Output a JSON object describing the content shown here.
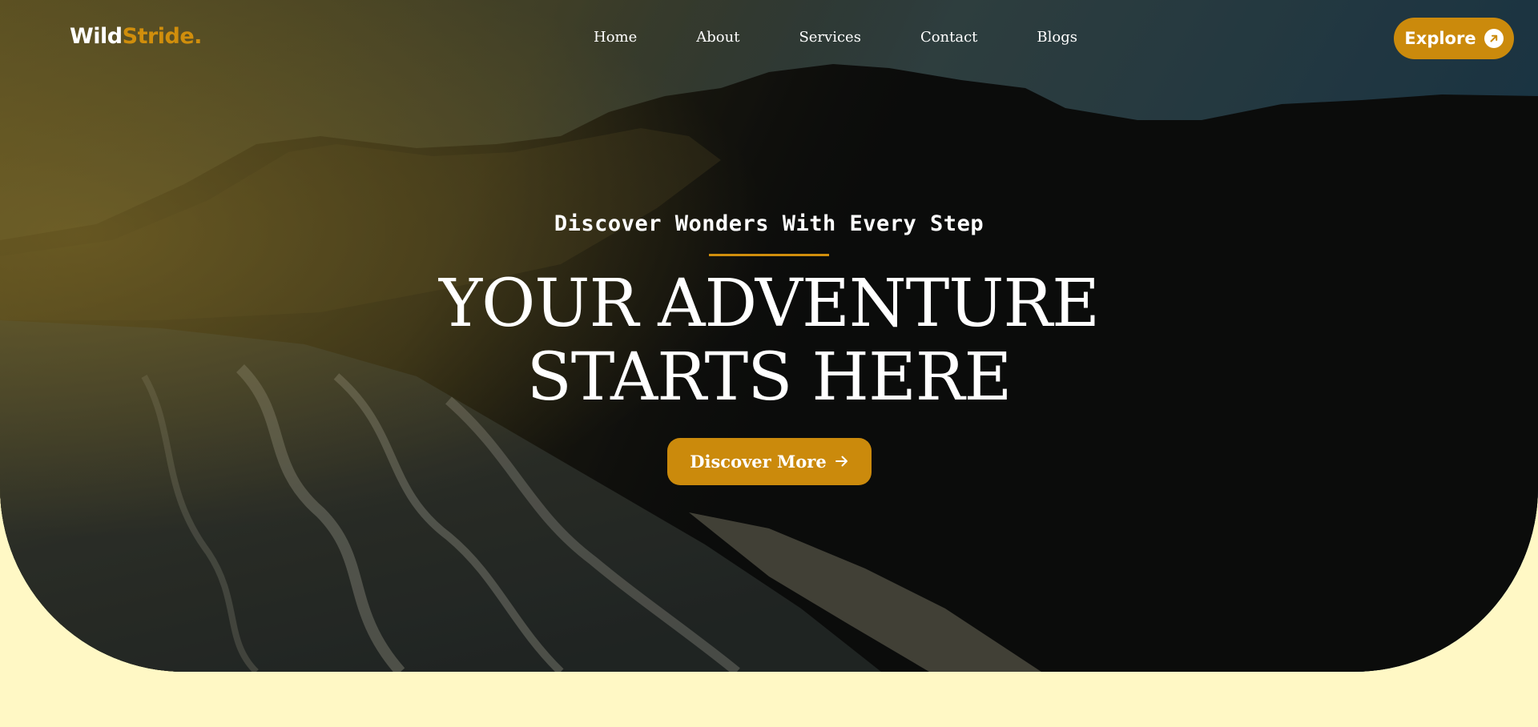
{
  "brand": {
    "part_a": "Wild",
    "part_b": "Stride.",
    "accent_color": "#d08e0c"
  },
  "nav": {
    "items": [
      "Home",
      "About",
      "Services",
      "Contact",
      "Blogs"
    ]
  },
  "explore_button": {
    "label": "Explore",
    "icon": "arrow-up-right-icon"
  },
  "hero": {
    "kicker": "Discover Wonders With Every Step",
    "headline_line1": "YOUR ADVENTURE",
    "headline_line2": "STARTS HERE",
    "cta_label": "Discover More",
    "cta_icon": "arrow-right-icon",
    "background_description_color": "#0b0c0c"
  },
  "page": {
    "background_color": "#fff8c5"
  }
}
